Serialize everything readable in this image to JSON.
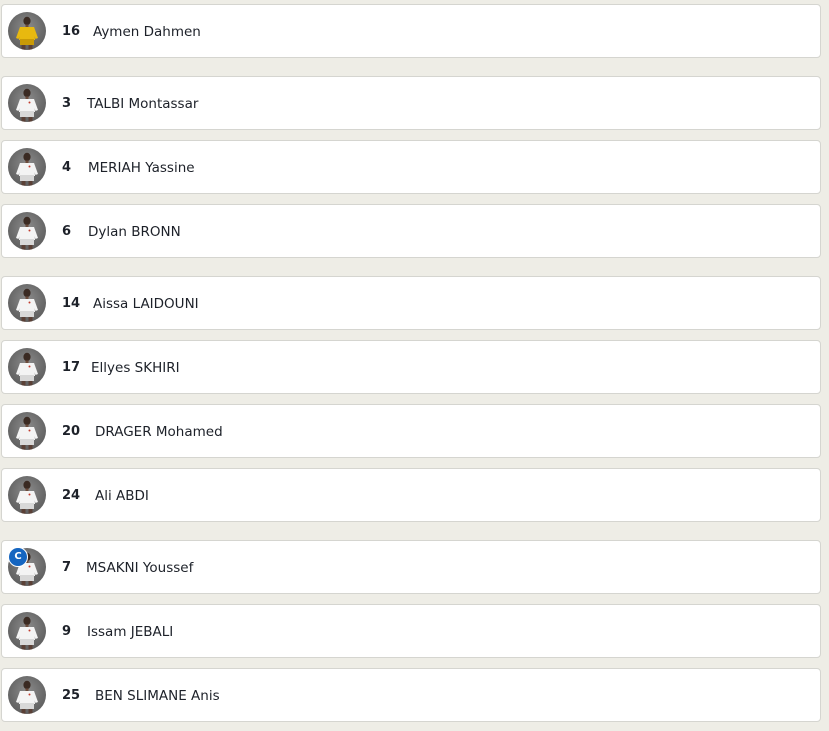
{
  "players": [
    {
      "number": "16",
      "name": "Aymen Dahmen",
      "kit": "yellow",
      "captain": false
    },
    {
      "number": "3",
      "name": "TALBI Montassar",
      "kit": "white",
      "captain": false
    },
    {
      "number": "4",
      "name": "MERIAH Yassine",
      "kit": "white",
      "captain": false
    },
    {
      "number": "6",
      "name": "Dylan BRONN",
      "kit": "white",
      "captain": false
    },
    {
      "number": "14",
      "name": "Aissa LAIDOUNI",
      "kit": "white",
      "captain": false
    },
    {
      "number": "17",
      "name": "Ellyes SKHIRI",
      "kit": "white",
      "captain": false
    },
    {
      "number": "20",
      "name": "DRAGER Mohamed",
      "kit": "white",
      "captain": false
    },
    {
      "number": "24",
      "name": "Ali ABDI",
      "kit": "white",
      "captain": false
    },
    {
      "number": "7",
      "name": "MSAKNI Youssef",
      "kit": "white",
      "captain": true,
      "captain_badge": "C"
    },
    {
      "number": "9",
      "name": "Issam JEBALI",
      "kit": "white",
      "captain": false
    },
    {
      "number": "25",
      "name": "BEN SLIMANE Anis",
      "kit": "white",
      "captain": false
    }
  ],
  "colors": {
    "background": "#eeede6",
    "card": "#ffffff",
    "text": "#1d2129",
    "captain_badge": "#1565c0",
    "goalkeeper_kit": "#e8b90f",
    "outfield_kit": "#f4f4f4"
  }
}
